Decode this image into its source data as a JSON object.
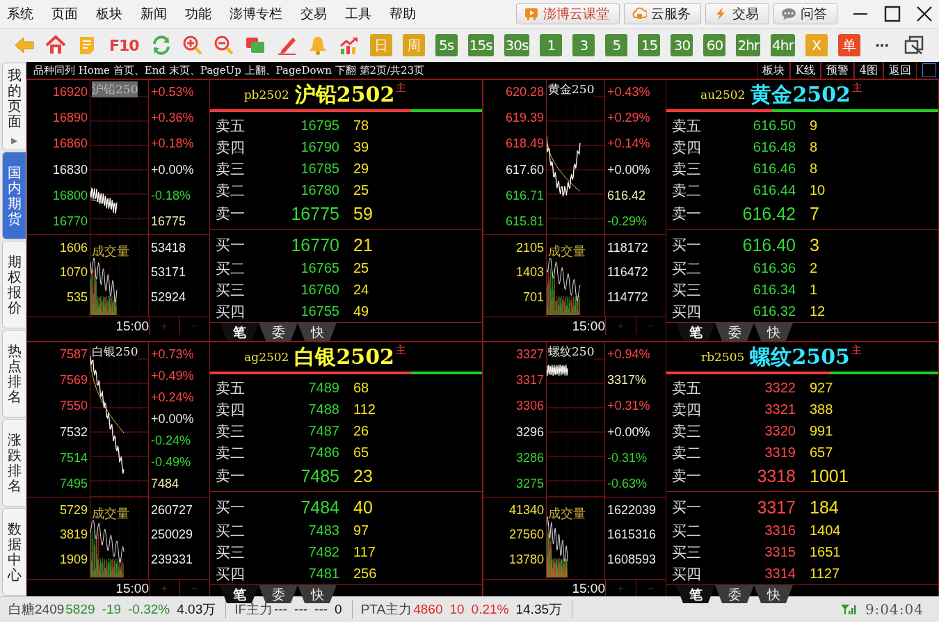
{
  "menu": [
    "系统",
    "页面",
    "板块",
    "新闻",
    "功能",
    "澎博专栏",
    "交易",
    "工具",
    "帮助"
  ],
  "top_buttons": [
    {
      "label": "澎博云课堂",
      "kind": "course"
    },
    {
      "label": "云服务",
      "kind": "cloud"
    },
    {
      "label": "交易",
      "kind": "trade"
    },
    {
      "label": "问答",
      "kind": "qa"
    }
  ],
  "toolbar": [
    {
      "kind": "back"
    },
    {
      "kind": "home"
    },
    {
      "kind": "note"
    },
    {
      "kind": "plain",
      "label": "F10"
    },
    {
      "kind": "refresh"
    },
    {
      "kind": "zoomin"
    },
    {
      "kind": "zoomout"
    },
    {
      "kind": "windows"
    },
    {
      "kind": "pen"
    },
    {
      "kind": "bell"
    },
    {
      "kind": "chart"
    },
    {
      "kind": "gold",
      "label": "日"
    },
    {
      "kind": "gold",
      "label": "周"
    },
    {
      "kind": "green",
      "label": "5s"
    },
    {
      "kind": "green",
      "label": "15s"
    },
    {
      "kind": "green",
      "label": "30s"
    },
    {
      "kind": "green",
      "label": "1"
    },
    {
      "kind": "green",
      "label": "3"
    },
    {
      "kind": "green",
      "label": "5"
    },
    {
      "kind": "green",
      "label": "15"
    },
    {
      "kind": "green",
      "label": "30"
    },
    {
      "kind": "green",
      "label": "60"
    },
    {
      "kind": "green",
      "label": "2hr"
    },
    {
      "kind": "green",
      "label": "4hr"
    },
    {
      "kind": "orange",
      "label": "X"
    },
    {
      "kind": "red",
      "label": "单"
    },
    {
      "kind": "dots",
      "label": "···"
    },
    {
      "kind": "restore"
    }
  ],
  "sidebar": [
    {
      "label": "我的页面",
      "selected": false,
      "arrow": "▶"
    },
    {
      "label": "国内期货",
      "selected": true
    },
    {
      "label": "期权报价",
      "selected": false
    },
    {
      "label": "热点排名",
      "selected": false
    },
    {
      "label": "涨跌排名",
      "selected": false
    },
    {
      "label": "数据中心",
      "selected": false
    }
  ],
  "header": {
    "hint": "品种同列 Home 首页、End 末页、PageUp 上翻、PageDown 下翻 第2页/共23页",
    "buttons": [
      "板块",
      "K线",
      "预警",
      "4图",
      "返回"
    ]
  },
  "panels": [
    {
      "chart_title": "沪铅250",
      "highlighted": true,
      "price_labels": [
        {
          "text": "16920",
          "kind": "up"
        },
        {
          "text": "16890",
          "kind": "up"
        },
        {
          "text": "16860",
          "kind": "up"
        },
        {
          "text": "16830",
          "kind": "flat"
        },
        {
          "text": "16800",
          "kind": "down"
        },
        {
          "text": "16770",
          "kind": "down"
        }
      ],
      "pct_labels": [
        {
          "text": "+0.53%",
          "kind": "up"
        },
        {
          "text": "+0.36%",
          "kind": "up"
        },
        {
          "text": "+0.18%",
          "kind": "up"
        },
        {
          "text": "+0.00%",
          "kind": "flat"
        },
        {
          "text": "-0.18%",
          "kind": "down"
        },
        {
          "text": "16775",
          "kind": "marker"
        }
      ],
      "volume_title": "成交量",
      "volume_labels": [
        "1606",
        "1070",
        "535"
      ],
      "interest_labels": [
        "53418",
        "53171",
        "52924"
      ],
      "time": "15:00",
      "plus": "+",
      "minus": "−",
      "code": "pb2502",
      "name": {
        "text": "沪铅2502",
        "kind": "yellow"
      },
      "badge": "主",
      "level": 0.74,
      "kind": "falling",
      "asks": [
        {
          "label": "卖五",
          "price": "16795",
          "volume": "78"
        },
        {
          "label": "卖四",
          "price": "16790",
          "volume": "39"
        },
        {
          "label": "卖三",
          "price": "16785",
          "volume": "29"
        },
        {
          "label": "卖二",
          "price": "16780",
          "volume": "25"
        },
        {
          "label": "卖一",
          "price": "16775",
          "volume": "59"
        }
      ],
      "bids": [
        {
          "label": "买一",
          "price": "16770",
          "volume": "21"
        },
        {
          "label": "买二",
          "price": "16765",
          "volume": "25"
        },
        {
          "label": "买三",
          "price": "16760",
          "volume": "24"
        },
        {
          "label": "买四",
          "price": "16755",
          "volume": "49"
        }
      ],
      "tabs": [
        {
          "label": "笔",
          "selected": true
        },
        {
          "label": "委",
          "selected": false
        },
        {
          "label": "快",
          "selected": false
        }
      ]
    },
    {
      "chart_title": "黄金250",
      "highlighted": false,
      "price_labels": [
        {
          "text": "620.28",
          "kind": "up"
        },
        {
          "text": "619.39",
          "kind": "up"
        },
        {
          "text": "618.49",
          "kind": "up"
        },
        {
          "text": "617.60",
          "kind": "flat"
        },
        {
          "text": "616.71",
          "kind": "down"
        },
        {
          "text": "615.81",
          "kind": "down"
        }
      ],
      "pct_labels": [
        {
          "text": "+0.43%",
          "kind": "up"
        },
        {
          "text": "+0.29%",
          "kind": "up"
        },
        {
          "text": "+0.14%",
          "kind": "up"
        },
        {
          "text": "+0.00%",
          "kind": "flat"
        },
        {
          "text": "616.42",
          "kind": "marker"
        },
        {
          "text": "-0.29%",
          "kind": "down"
        }
      ],
      "volume_title": "成交量",
      "volume_labels": [
        "2105",
        "1403",
        "701"
      ],
      "interest_labels": [
        "118172",
        "116472",
        "114772"
      ],
      "time": "15:00",
      "plus": "+",
      "minus": "−",
      "code": "au2502",
      "name": {
        "text": "黄金2502",
        "kind": "cyan"
      },
      "badge": "主",
      "level": 0.39,
      "kind": "falling",
      "asks": [
        {
          "label": "卖五",
          "price": "616.50",
          "volume": "9"
        },
        {
          "label": "卖四",
          "price": "616.48",
          "volume": "8"
        },
        {
          "label": "卖三",
          "price": "616.46",
          "volume": "8"
        },
        {
          "label": "卖二",
          "price": "616.44",
          "volume": "10"
        },
        {
          "label": "卖一",
          "price": "616.42",
          "volume": "7"
        }
      ],
      "bids": [
        {
          "label": "买一",
          "price": "616.40",
          "volume": "3"
        },
        {
          "label": "买二",
          "price": "616.36",
          "volume": "2"
        },
        {
          "label": "买三",
          "price": "616.34",
          "volume": "1"
        },
        {
          "label": "买四",
          "price": "616.32",
          "volume": "12"
        }
      ],
      "tabs": [
        {
          "label": "笔",
          "selected": true
        },
        {
          "label": "委",
          "selected": false
        },
        {
          "label": "快",
          "selected": false
        }
      ]
    },
    {
      "chart_title": "白银250",
      "highlighted": false,
      "price_labels": [
        {
          "text": "7587",
          "kind": "up"
        },
        {
          "text": "7569",
          "kind": "up"
        },
        {
          "text": "7550",
          "kind": "up"
        },
        {
          "text": "7532",
          "kind": "flat"
        },
        {
          "text": "7514",
          "kind": "down"
        },
        {
          "text": "7495",
          "kind": "down"
        }
      ],
      "pct_labels": [
        {
          "text": "+0.73%",
          "kind": "up"
        },
        {
          "text": "+0.49%",
          "kind": "up"
        },
        {
          "text": "+0.24%",
          "kind": "up"
        },
        {
          "text": "+0.00%",
          "kind": "flat"
        },
        {
          "text": "-0.24%",
          "kind": "down"
        },
        {
          "text": "-0.49%",
          "kind": "down"
        },
        {
          "text": "7484",
          "kind": "marker"
        }
      ],
      "volume_title": "成交量",
      "volume_labels": [
        "5729",
        "3819",
        "1909"
      ],
      "interest_labels": [
        "260727",
        "250029",
        "239331"
      ],
      "time": "15:00",
      "plus": "+",
      "minus": "−",
      "code": "ag2502",
      "name": {
        "text": "白银2502",
        "kind": "yellow"
      },
      "badge": "主",
      "level": 0.74,
      "kind": "falling",
      "asks": [
        {
          "label": "卖五",
          "price": "7489",
          "volume": "68"
        },
        {
          "label": "卖四",
          "price": "7488",
          "volume": "112"
        },
        {
          "label": "卖三",
          "price": "7487",
          "volume": "26"
        },
        {
          "label": "卖二",
          "price": "7486",
          "volume": "65"
        },
        {
          "label": "卖一",
          "price": "7485",
          "volume": "23"
        }
      ],
      "bids": [
        {
          "label": "买一",
          "price": "7484",
          "volume": "40"
        },
        {
          "label": "买二",
          "price": "7483",
          "volume": "97"
        },
        {
          "label": "买三",
          "price": "7482",
          "volume": "117"
        },
        {
          "label": "买四",
          "price": "7481",
          "volume": "256"
        }
      ],
      "tabs": [
        {
          "label": "笔",
          "selected": true
        },
        {
          "label": "委",
          "selected": false
        },
        {
          "label": "快",
          "selected": false
        }
      ]
    },
    {
      "chart_title": "螺纹250",
      "highlighted": false,
      "price_labels": [
        {
          "text": "3327",
          "kind": "up"
        },
        {
          "text": "3317",
          "kind": "up"
        },
        {
          "text": "3306",
          "kind": "up"
        },
        {
          "text": "3296",
          "kind": "flat"
        },
        {
          "text": "3286",
          "kind": "down"
        },
        {
          "text": "3275",
          "kind": "down"
        }
      ],
      "pct_labels": [
        {
          "text": "+0.94%",
          "kind": "up"
        },
        {
          "text": "3317%",
          "kind": "marker"
        },
        {
          "text": "+0.31%",
          "kind": "up"
        },
        {
          "text": "+0.00%",
          "kind": "flat"
        },
        {
          "text": "-0.31%",
          "kind": "down"
        },
        {
          "text": "-0.63%",
          "kind": "down"
        }
      ],
      "volume_title": "成交量",
      "volume_labels": [
        "41340",
        "27560",
        "13780"
      ],
      "interest_labels": [
        "1622039",
        "1615316",
        "1608593"
      ],
      "time": "15:00",
      "plus": "+",
      "minus": "−",
      "code": "rb2505",
      "name": {
        "text": "螺纹2505",
        "kind": "cyan"
      },
      "badge": "主",
      "level": 0.6,
      "kind": "rising",
      "asks": [
        {
          "label": "卖五",
          "price": "3322",
          "volume": "927"
        },
        {
          "label": "卖四",
          "price": "3321",
          "volume": "388"
        },
        {
          "label": "卖三",
          "price": "3320",
          "volume": "991"
        },
        {
          "label": "卖二",
          "price": "3319",
          "volume": "657"
        },
        {
          "label": "卖一",
          "price": "3318",
          "volume": "1001"
        }
      ],
      "bids": [
        {
          "label": "买一",
          "price": "3317",
          "volume": "184"
        },
        {
          "label": "买二",
          "price": "3316",
          "volume": "1404"
        },
        {
          "label": "买三",
          "price": "3315",
          "volume": "1651"
        },
        {
          "label": "买四",
          "price": "3314",
          "volume": "1127"
        }
      ],
      "tabs": [
        {
          "label": "笔",
          "selected": true
        },
        {
          "label": "委",
          "selected": false
        },
        {
          "label": "快",
          "selected": false
        }
      ]
    }
  ],
  "status_bar": {
    "quotes": [
      {
        "name": "白糖2409",
        "fields": [
          {
            "text": "5829",
            "kind": "down"
          },
          {
            "text": "-19",
            "kind": "down"
          },
          {
            "text": "-0.32%",
            "kind": "down"
          },
          {
            "text": "4.03万",
            "kind": "flat"
          }
        ]
      },
      {
        "name": "IF主力",
        "fields": [
          {
            "text": "---",
            "kind": "flat"
          },
          {
            "text": "---",
            "kind": "flat"
          },
          {
            "text": "---",
            "kind": "flat"
          },
          {
            "text": "0",
            "kind": "flat"
          }
        ]
      },
      {
        "name": "PTA主力",
        "fields": [
          {
            "text": "4860",
            "kind": "up"
          },
          {
            "text": "10",
            "kind": "up"
          },
          {
            "text": "0.21%",
            "kind": "up"
          },
          {
            "text": "14.35万",
            "kind": "flat"
          }
        ]
      }
    ],
    "time": "9:04:04"
  }
}
